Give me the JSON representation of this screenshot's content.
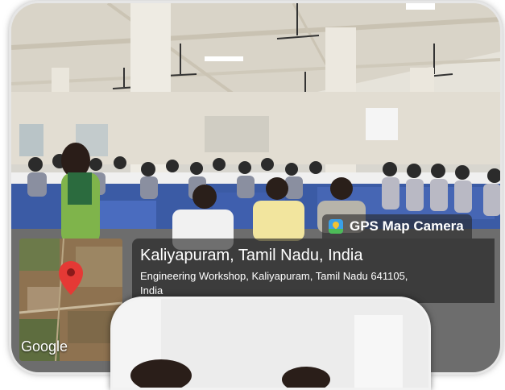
{
  "overlay": {
    "camera_app": "GPS Map Camera",
    "location_title": "Kaliyapuram, Tamil Nadu, India",
    "address_line1": "Engineering Workshop, Kaliyapuram, Tamil Nadu 641105,",
    "address_line2": "India",
    "map_label": "Google"
  },
  "icons": {
    "camera_app_icon": "gps-map-camera-icon",
    "map_pin": "map-pin-icon"
  },
  "colors": {
    "pin": "#e53935",
    "overlay_bg": "#282828",
    "badge_icon": "#3aa0e8"
  }
}
